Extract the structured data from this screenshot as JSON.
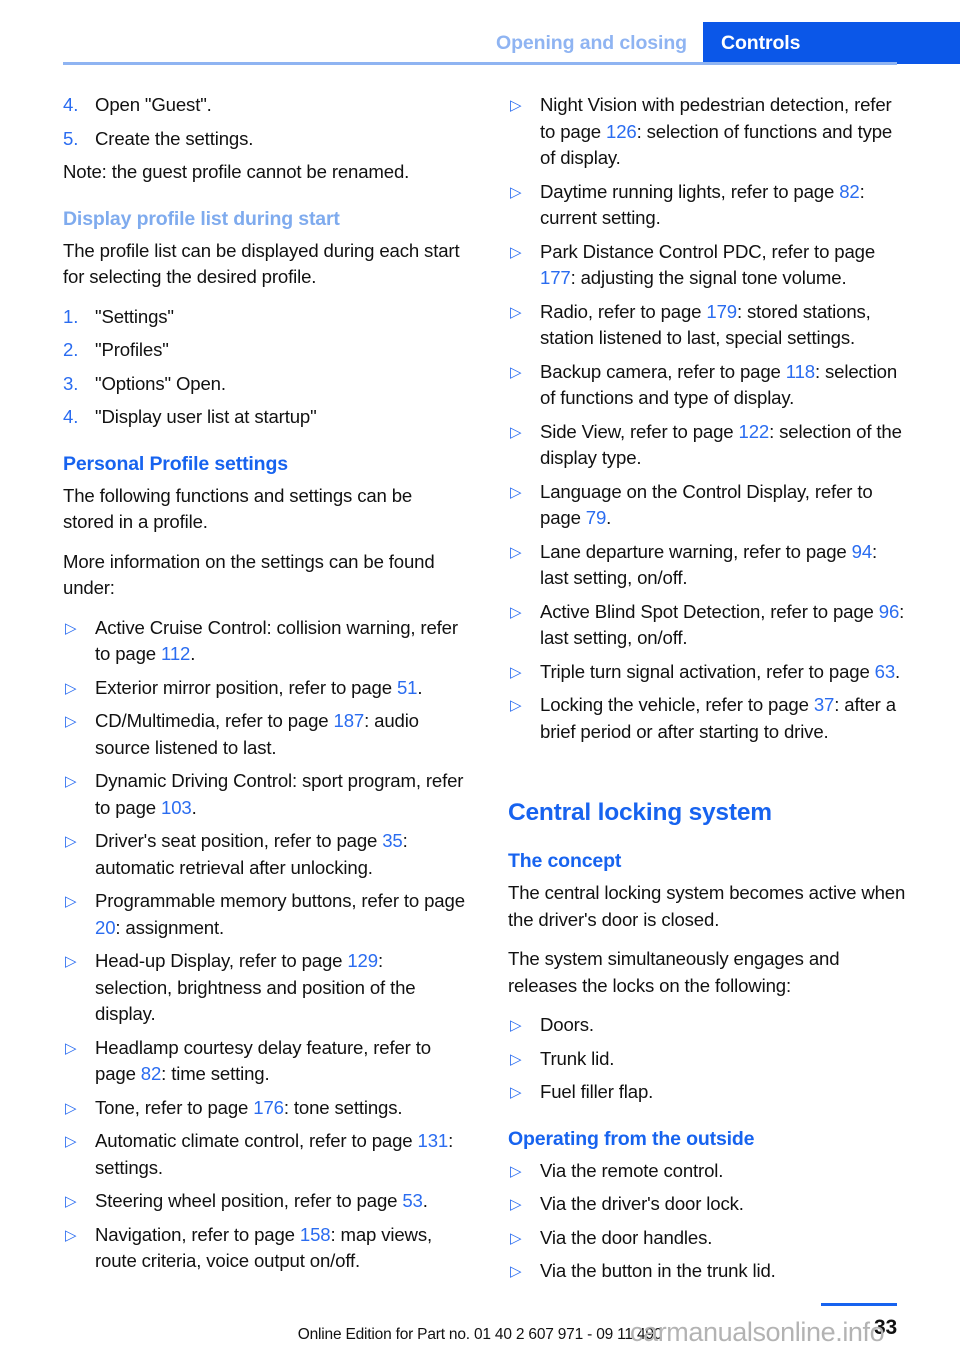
{
  "header": {
    "breadcrumb_muted": "Opening and closing",
    "tab_active": "Controls",
    "accent_color": "#0b57e8",
    "muted_color": "#8fb4f2"
  },
  "left_column": {
    "steps_top": [
      {
        "num": "4.",
        "text": "Open \"Guest\"."
      },
      {
        "num": "5.",
        "text": "Create the settings."
      }
    ],
    "note": "Note: the guest profile cannot be renamed.",
    "heading_display_profile": "Display profile list during start",
    "display_profile_intro": "The profile list can be displayed during each start for selecting the desired profile.",
    "display_profile_steps": [
      {
        "num": "1.",
        "text": "\"Settings\""
      },
      {
        "num": "2.",
        "text": "\"Profiles\""
      },
      {
        "num": "3.",
        "text": "\"Options\" Open."
      },
      {
        "num": "4.",
        "text": "\"Display user list at startup\""
      }
    ],
    "heading_personal_profile": "Personal Profile settings",
    "personal_intro_1": "The following functions and settings can be stored in a profile.",
    "personal_intro_2": "More information on the settings can be found under:",
    "settings_items": [
      {
        "pre": "Active Cruise Control: collision warning, refer to page ",
        "page": "112",
        "post": "."
      },
      {
        "pre": "Exterior mirror position, refer to page ",
        "page": "51",
        "post": "."
      },
      {
        "pre": "CD/Multimedia, refer to page ",
        "page": "187",
        "post": ": audio source listened to last."
      },
      {
        "pre": "Dynamic Driving Control: sport program, refer to page ",
        "page": "103",
        "post": "."
      },
      {
        "pre": "Driver's seat position, refer to page ",
        "page": "35",
        "post": ": automatic retrieval after unlocking."
      },
      {
        "pre": "Programmable memory buttons, refer to page ",
        "page": "20",
        "post": ": assignment."
      },
      {
        "pre": "Head-up Display, refer to page ",
        "page": "129",
        "post": ": selection, brightness and position of the display."
      },
      {
        "pre": "Headlamp courtesy delay feature, refer to page ",
        "page": "82",
        "post": ": time setting."
      },
      {
        "pre": "Tone, refer to page ",
        "page": "176",
        "post": ": tone settings."
      },
      {
        "pre": "Automatic climate control, refer to page ",
        "page": "131",
        "post": ": settings."
      },
      {
        "pre": "Steering wheel position, refer to page ",
        "page": "53",
        "post": "."
      },
      {
        "pre": "Navigation, refer to page ",
        "page": "158",
        "post": ": map views, route criteria, voice output on/off."
      }
    ]
  },
  "right_column": {
    "settings_items": [
      {
        "pre": "Night Vision with pedestrian detection, refer to page ",
        "page": "126",
        "post": ": selection of functions and type of display."
      },
      {
        "pre": "Daytime running lights, refer to page ",
        "page": "82",
        "post": ": current setting."
      },
      {
        "pre": "Park Distance Control PDC, refer to page ",
        "page": "177",
        "post": ": adjusting the signal tone volume."
      },
      {
        "pre": "Radio, refer to page ",
        "page": "179",
        "post": ": stored stations, station listened to last, special settings."
      },
      {
        "pre": "Backup camera, refer to page ",
        "page": "118",
        "post": ": selection of functions and type of display."
      },
      {
        "pre": "Side View, refer to page ",
        "page": "122",
        "post": ": selection of the display type."
      },
      {
        "pre": "Language on the Control Display, refer to page ",
        "page": "79",
        "post": "."
      },
      {
        "pre": "Lane departure warning, refer to page ",
        "page": "94",
        "post": ": last setting, on/off."
      },
      {
        "pre": "Active Blind Spot Detection, refer to page ",
        "page": "96",
        "post": ": last setting, on/off."
      },
      {
        "pre": "Triple turn signal activation, refer to page ",
        "page": "63",
        "post": "."
      },
      {
        "pre": "Locking the vehicle, refer to page ",
        "page": "37",
        "post": ": after a brief period or after starting to drive."
      }
    ],
    "heading_central_locking": "Central locking system",
    "heading_the_concept": "The concept",
    "concept_para_1": "The central locking system becomes active when the driver's door is closed.",
    "concept_para_2": "The system simultaneously engages and releases the locks on the following:",
    "concept_items": [
      {
        "pre": "Doors.",
        "page": "",
        "post": ""
      },
      {
        "pre": "Trunk lid.",
        "page": "",
        "post": ""
      },
      {
        "pre": "Fuel filler flap.",
        "page": "",
        "post": ""
      }
    ],
    "heading_operating_outside": "Operating from the outside",
    "operating_items": [
      {
        "pre": "Via the remote control.",
        "page": "",
        "post": ""
      },
      {
        "pre": "Via the driver's door lock.",
        "page": "",
        "post": ""
      },
      {
        "pre": "Via the door handles.",
        "page": "",
        "post": ""
      },
      {
        "pre": "Via the button in the trunk lid.",
        "page": "",
        "post": ""
      }
    ]
  },
  "footer": {
    "edition": "Online Edition for Part no. 01 40 2 607 971 - 09 11 490",
    "page_number": "33",
    "watermark": "carmanualsonline.info"
  },
  "icons": {
    "bullet": "▷"
  }
}
